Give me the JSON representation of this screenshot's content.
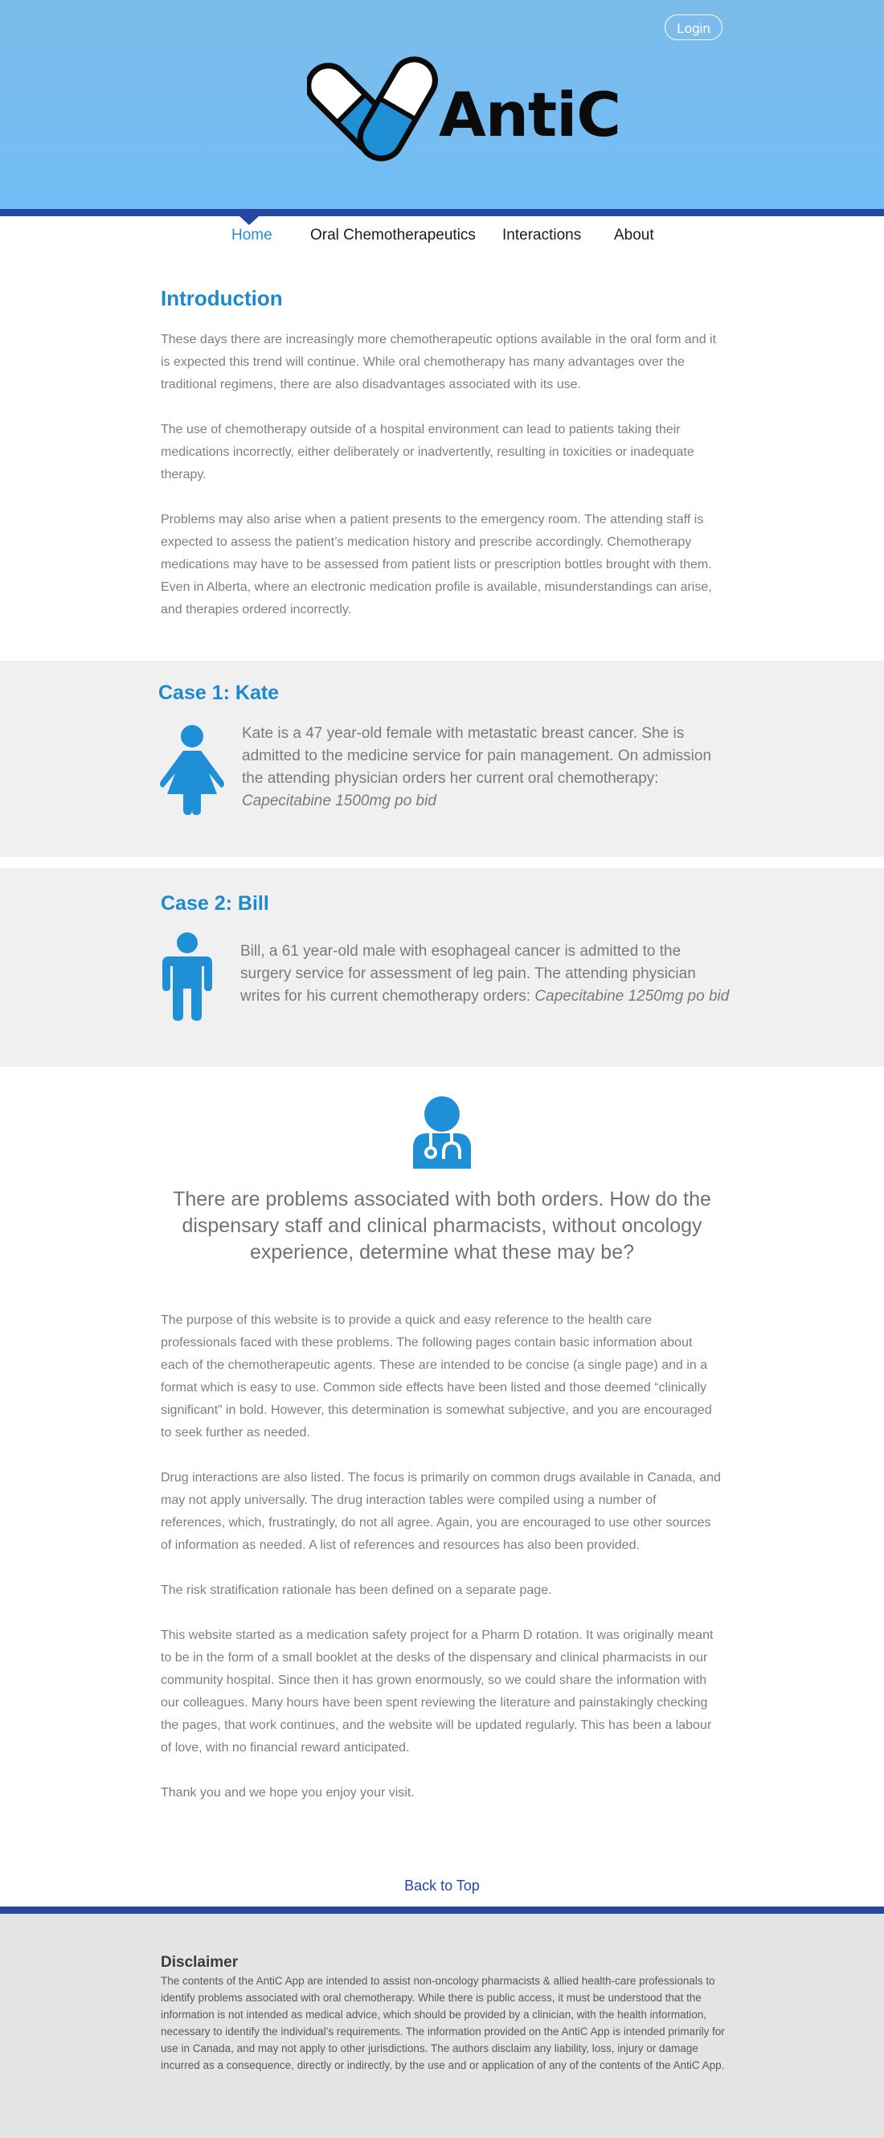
{
  "header": {
    "login_label": "Login",
    "logo_text": "AntiC",
    "colors": {
      "sky": "#72bdf6",
      "bar": "#2447a2",
      "accent": "#1f8acb",
      "capsule_blue": "#1f8fd6"
    }
  },
  "nav": {
    "items": [
      {
        "label": "Home",
        "active": true
      },
      {
        "label": "Oral Chemotherapeutics"
      },
      {
        "label": "Interactions"
      },
      {
        "label": "About"
      }
    ]
  },
  "intro": {
    "title": "Introduction",
    "paragraphs": [
      "These days there are increasingly more chemotherapeutic options available in the oral form and it is expected this trend will continue. While oral chemotherapy has many advantages over the traditional regimens, there are also disadvantages associated with its use.",
      "The use of chemotherapy outside of a hospital environment can lead to patients taking their medications incorrectly, either deliberately or inadvertently, resulting in toxicities or inadequate therapy.",
      "Problems may also arise when a patient presents to the emergency room. The attending staff is expected to assess the patient’s medication history and prescribe accordingly. Chemotherapy medications may have to be assessed from patient lists or prescription bottles brought with them. Even in Alberta, where an electronic medication profile is available, misunderstandings can arise, and therapies ordered incorrectly."
    ]
  },
  "cases": [
    {
      "title": "Case 1: Kate",
      "icon": "female-person-icon",
      "text": "Kate is a 47 year-old female with metastatic breast cancer. She is admitted to the medicine service for pain management. On admission the attending physician orders her current oral chemotherapy:",
      "order": "Capecitabine 1500mg po bid"
    },
    {
      "title": "Case 2: Bill",
      "icon": "male-person-icon",
      "text": "Bill, a 61 year-old male with esophageal cancer is admitted to the surgery service for assessment of leg pain. The attending physician writes for his current chemotherapy orders:",
      "order": "Capecitabine 1250mg po bid"
    }
  ],
  "question": {
    "icon": "doctor-icon",
    "text": "There are problems associated with both orders. How do the dispensary staff and clinical pharmacists, without oncology experience, determine what these may be?"
  },
  "purpose": {
    "paragraphs": [
      "The purpose of this website is to provide a quick and easy reference to the health care professionals faced with these problems. The following pages contain basic information about each of the chemotherapeutic agents. These are intended to be concise (a single page) and in a format which is easy to use. Common side effects have been listed and those deemed “clinically significant” in bold. However, this determination is somewhat subjective, and you are encouraged to seek further as needed.",
      "Drug interactions are also listed. The focus is primarily on common drugs available in Canada, and may not apply universally. The drug interaction tables were compiled using a number of references, which, frustratingly, do not all agree. Again, you are encouraged to use other sources of information as needed. A list of references and resources has also been provided.",
      "The risk stratification rationale has been defined on a separate page.",
      "This website started as a medication safety project for a Pharm D rotation. It was originally meant to be in the form of a small booklet at the desks of the dispensary and clinical pharmacists in our community hospital. Since then it has grown enormously, so we could share the information with our colleagues. Many hours have been spent reviewing the literature and painstakingly checking the pages, that work continues, and the website will be updated regularly. This has been a labour of love, with no financial reward anticipated.",
      "Thank you and we hope you enjoy your visit."
    ]
  },
  "back_to_top": "Back to Top",
  "footer": {
    "disclaimer_title": "Disclaimer",
    "disclaimer_text": "The contents of the AntiC App are intended to assist non-oncology pharmacists & allied health-care professionals to identify problems associated with oral chemotherapy. While there is public access, it must be understood that the information is not intended as medical advice, which should be provided by a clinician, with the health information, necessary to identify the individual’s requirements. The information provided on the AntiC App is intended primarily for use in Canada, and may not apply to other jurisdictions. The authors disclaim any liability, loss, injury or damage incurred as a consequence, directly or indirectly, by the use and or application of any of the contents of the AntiC App."
  }
}
